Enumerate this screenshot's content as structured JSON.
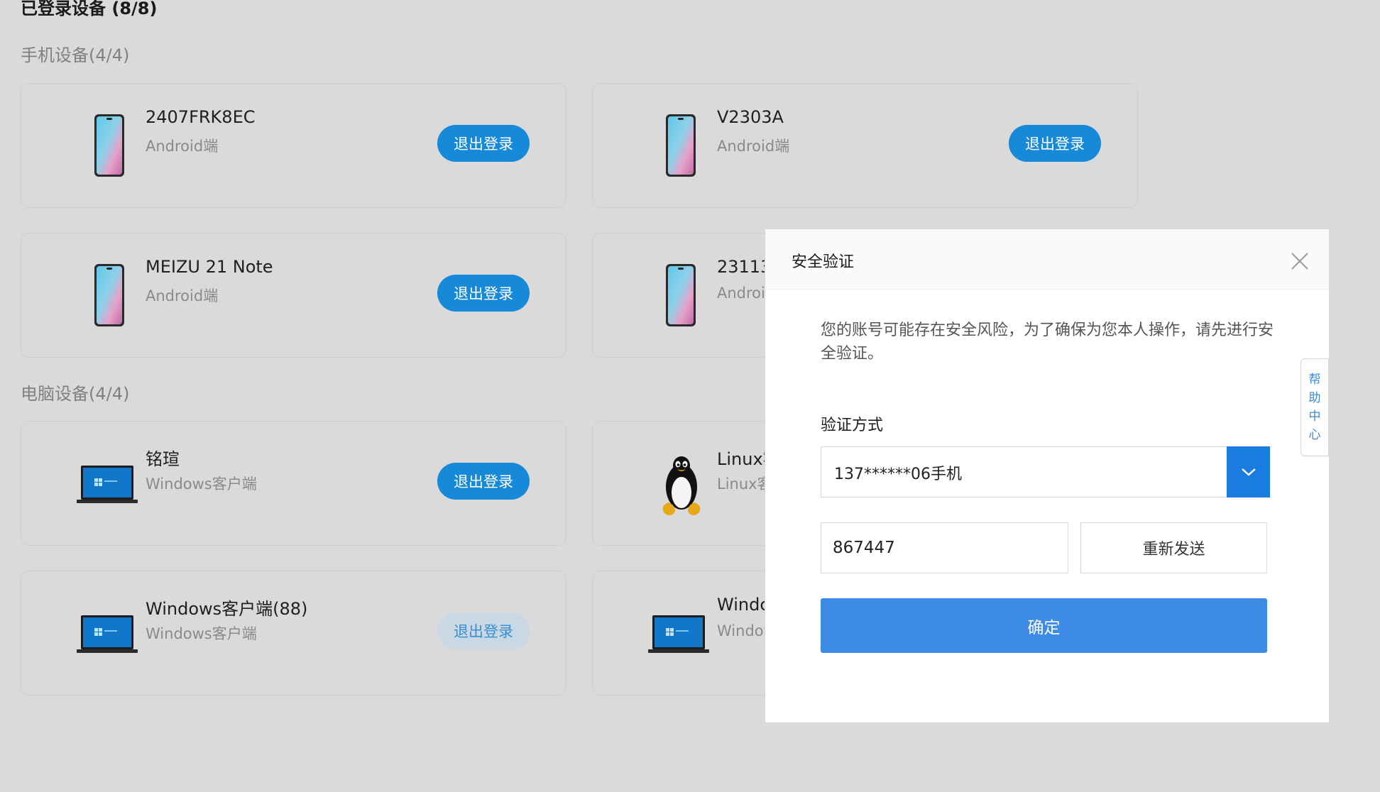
{
  "page": {
    "title": "已登录设备 (8/8)",
    "phone_section": "手机设备(4/4)",
    "pc_section": "电脑设备(4/4)",
    "logout_label": "退出登录"
  },
  "phones": [
    {
      "name": "2407FRK8EC",
      "platform": "Android端"
    },
    {
      "name": "V2303A",
      "platform": "Android端"
    },
    {
      "name": "MEIZU 21 Note",
      "platform": "Android端"
    },
    {
      "name": "23113",
      "platform": "Androi"
    }
  ],
  "computers": [
    {
      "name": "铭瑄",
      "platform": "Windows客户端"
    },
    {
      "name": "Linux客",
      "platform": "Linux客"
    },
    {
      "name": "Windows客户端(88)",
      "platform": "Windows客户端"
    },
    {
      "name": "Windc",
      "platform": "Windov"
    }
  ],
  "dialog": {
    "title": "安全验证",
    "message": "您的账号可能存在安全风险，为了确保为您本人操作，请先进行安全验证。",
    "method_label": "验证方式",
    "method_value": "137******06手机",
    "code_value": "867447",
    "resend_label": "重新发送",
    "confirm_label": "确定"
  },
  "help_tab": {
    "chars": [
      "帮",
      "助",
      "中",
      "心"
    ]
  },
  "colors": {
    "background": "#dadada",
    "primary_button": "#1689d8",
    "confirm_button": "#3e8be6",
    "select_arrow_bg": "#1b7ce0"
  }
}
